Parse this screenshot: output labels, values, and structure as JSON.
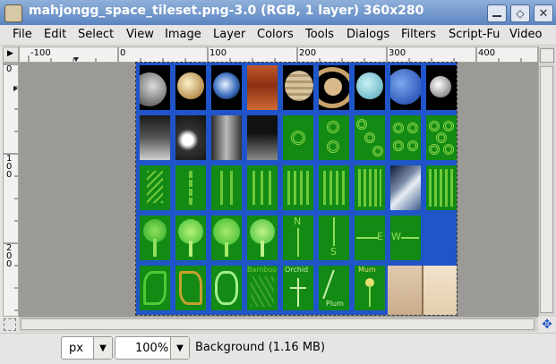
{
  "window": {
    "title": "mahjongg_space_tileset.png-3.0 (RGB, 1 layer) 360x280",
    "controls": [
      "minimize",
      "maximize",
      "close"
    ]
  },
  "menubar": {
    "items": [
      {
        "label": "File"
      },
      {
        "label": "Edit"
      },
      {
        "label": "Select"
      },
      {
        "label": "View"
      },
      {
        "label": "Image"
      },
      {
        "label": "Layer"
      },
      {
        "label": "Colors"
      },
      {
        "label": "Tools"
      },
      {
        "label": "Dialogs"
      },
      {
        "label": "Filters"
      },
      {
        "label": "Script-Fu"
      },
      {
        "label": "Video"
      }
    ]
  },
  "rulers": {
    "horizontal_labels": [
      "-100",
      "0",
      "100",
      "200",
      "300",
      "400"
    ],
    "vertical_labels": [
      "0",
      "100",
      "200"
    ]
  },
  "image": {
    "tile_text": {
      "bamboo": "Bamboo",
      "orchid": "Orchid",
      "plum": "Plum",
      "mum": "Mum",
      "n": "N",
      "s": "S",
      "e": "E",
      "w": "W"
    }
  },
  "status": {
    "unit": "px",
    "zoom": "100%",
    "layer_info": "Background (1.16 MB)"
  },
  "colors": {
    "tile_blue": "#1f55c8",
    "tile_green": "#138a13",
    "title_bar": "#6b90c8"
  }
}
